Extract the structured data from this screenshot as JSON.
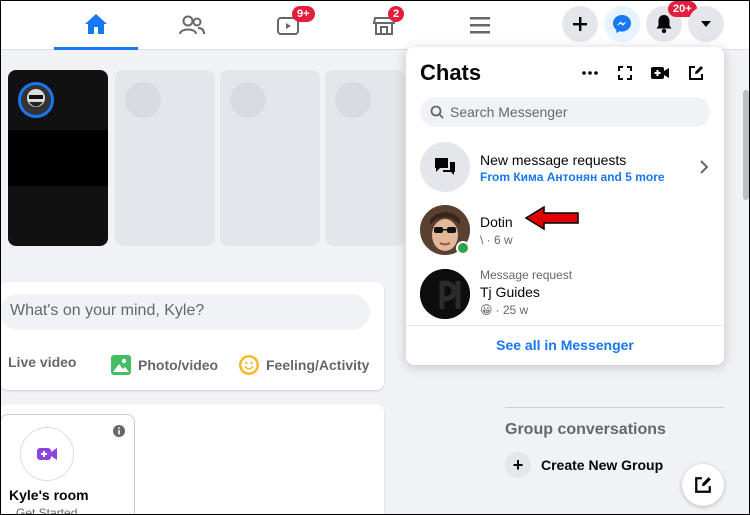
{
  "nav": {
    "tabs": [
      {
        "name": "home",
        "active": true
      },
      {
        "name": "friends",
        "active": false
      },
      {
        "name": "watch",
        "badge": "9+"
      },
      {
        "name": "marketplace",
        "badge": "2"
      },
      {
        "name": "menu"
      }
    ],
    "notifications_badge": "20+"
  },
  "composer": {
    "placeholder": "What's on your mind, Kyle?",
    "live_video": "Live video",
    "photo_video": "Photo/video",
    "feeling": "Feeling/Activity"
  },
  "room": {
    "title": "Kyle's room",
    "subtitle": "Get Started"
  },
  "chats": {
    "title": "Chats",
    "search_placeholder": "Search Messenger",
    "items": [
      {
        "title": "New message requests",
        "subtitle": "From Кима Антонян and 5 more"
      },
      {
        "title": "Dotin",
        "subtitle": "\\ · 6 w"
      },
      {
        "label": "Message request",
        "title": "Tj Guides",
        "emoji": "😀",
        "subtitle": "· 25 w"
      }
    ],
    "see_all": "See all in Messenger"
  },
  "sidebar": {
    "group_heading": "Group conversations",
    "create_group": "Create New Group"
  },
  "colors": {
    "accent": "#1877f2",
    "badge": "#e41e3f",
    "online": "#31a24c"
  }
}
